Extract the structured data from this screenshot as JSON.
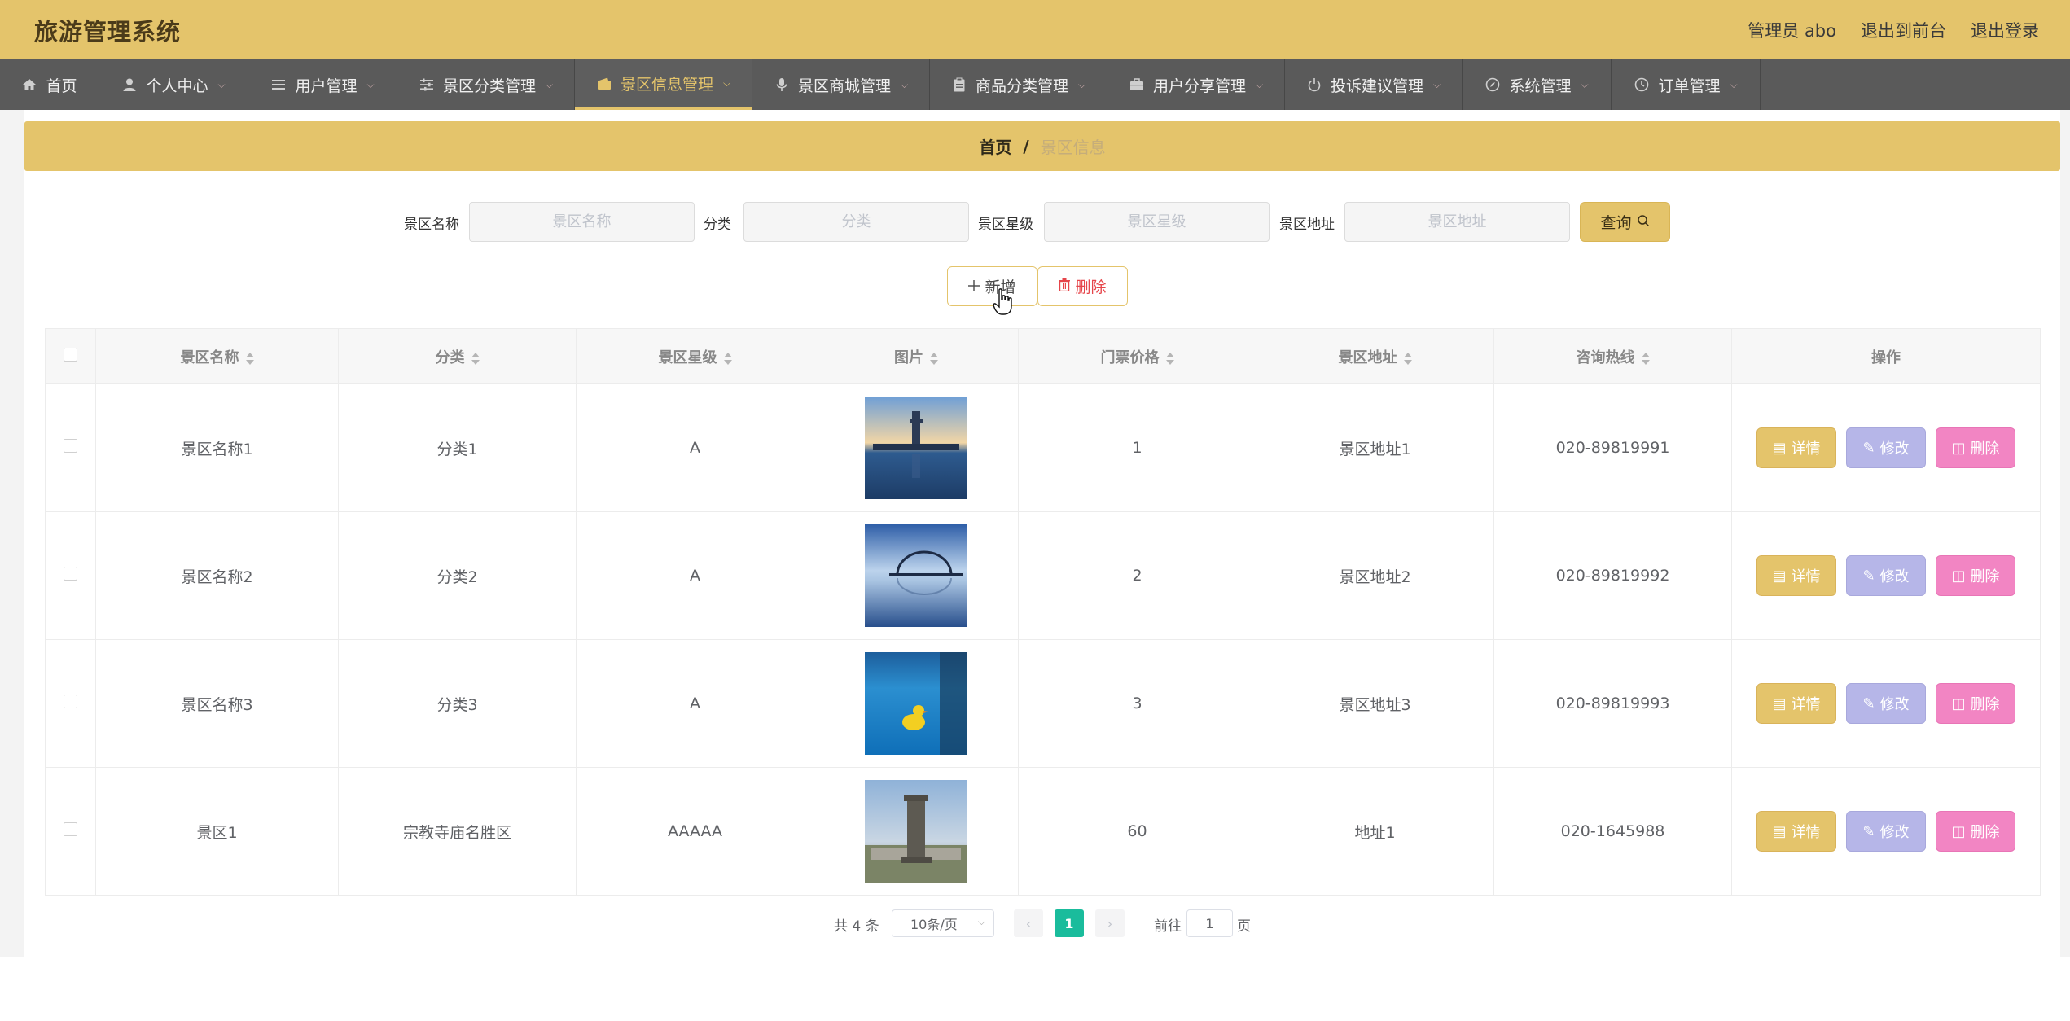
{
  "app": {
    "title": "旅游管理系统"
  },
  "header": {
    "admin": "管理员 abo",
    "to_front": "退出到前台",
    "logout": "退出登录"
  },
  "nav": {
    "items": [
      {
        "label": "首页",
        "icon": "home-icon"
      },
      {
        "label": "个人中心",
        "icon": "user-icon"
      },
      {
        "label": "用户管理",
        "icon": "list-icon"
      },
      {
        "label": "景区分类管理",
        "icon": "sliders-icon"
      },
      {
        "label": "景区信息管理",
        "icon": "wallet-icon",
        "active": true
      },
      {
        "label": "景区商城管理",
        "icon": "microphone-icon"
      },
      {
        "label": "商品分类管理",
        "icon": "clipboard-icon"
      },
      {
        "label": "用户分享管理",
        "icon": "briefcase-icon"
      },
      {
        "label": "投诉建议管理",
        "icon": "power-icon"
      },
      {
        "label": "系统管理",
        "icon": "compass-icon"
      },
      {
        "label": "订单管理",
        "icon": "clock-icon"
      }
    ]
  },
  "breadcrumb": {
    "home": "首页",
    "separator": "/",
    "current": "景区信息"
  },
  "search": {
    "name_label": "景区名称",
    "name_placeholder": "景区名称",
    "category_label": "分类",
    "category_placeholder": "分类",
    "star_label": "景区星级",
    "star_placeholder": "景区星级",
    "address_label": "景区地址",
    "address_placeholder": "景区地址",
    "query_label": "查询"
  },
  "actions": {
    "add_label": "新增",
    "delete_label": "删除"
  },
  "table": {
    "columns": [
      "景区名称",
      "分类",
      "景区星级",
      "图片",
      "门票价格",
      "景区地址",
      "咨询热线",
      "操作"
    ],
    "rows": [
      {
        "name": "景区名称1",
        "category": "分类1",
        "star": "A",
        "price": "1",
        "address": "景区地址1",
        "hotline": "020-89819991"
      },
      {
        "name": "景区名称2",
        "category": "分类2",
        "star": "A",
        "price": "2",
        "address": "景区地址2",
        "hotline": "020-89819992"
      },
      {
        "name": "景区名称3",
        "category": "分类3",
        "star": "A",
        "price": "3",
        "address": "景区地址3",
        "hotline": "020-89819993"
      },
      {
        "name": "景区1",
        "category": "宗教寺庙名胜区",
        "star": "AAAAA",
        "price": "60",
        "address": "地址1",
        "hotline": "020-1645988"
      }
    ],
    "row_actions": {
      "detail": "详情",
      "edit": "修改",
      "remove": "删除"
    }
  },
  "pagination": {
    "total": "共 4 条",
    "page_size": "10条/页",
    "current": "1",
    "goto_label": "前往",
    "goto_value": "1",
    "unit": "页"
  },
  "colors": {
    "brand": "#e4c46b",
    "nav": "#5a5a5a",
    "edit": "#b6b6e8",
    "remove": "#f285c3",
    "page_active": "#1abc9c"
  }
}
